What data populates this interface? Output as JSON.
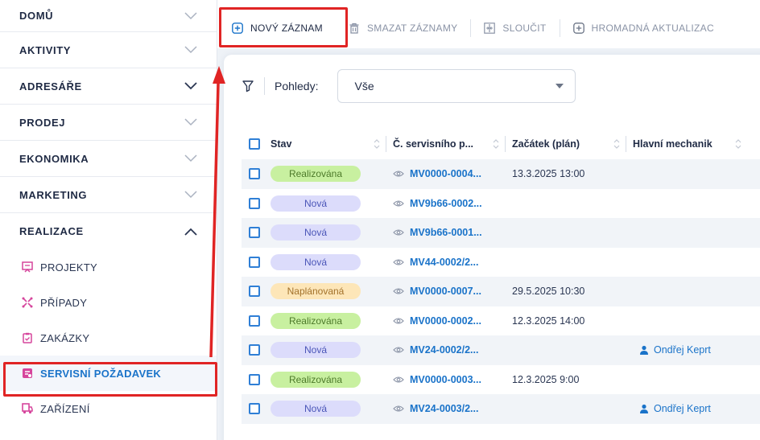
{
  "sidebar": {
    "sections": [
      {
        "label": "DOMŮ"
      },
      {
        "label": "AKTIVITY"
      },
      {
        "label": "ADRESÁŘE"
      },
      {
        "label": "PRODEJ"
      },
      {
        "label": "EKONOMIKA"
      },
      {
        "label": "MARKETING"
      },
      {
        "label": "REALIZACE"
      }
    ],
    "sub_items": [
      {
        "label": "PROJEKTY",
        "icon": "projects-icon"
      },
      {
        "label": "PŘÍPADY",
        "icon": "cases-icon"
      },
      {
        "label": "ZAKÁZKY",
        "icon": "orders-icon"
      },
      {
        "label": "SERVISNÍ POŽADAVEK",
        "icon": "service-request-icon"
      },
      {
        "label": "ZAŘÍZENÍ",
        "icon": "device-icon"
      }
    ]
  },
  "toolbar": {
    "new_label": "NOVÝ ZÁZNAM",
    "delete_label": "SMAZAT ZÁZNAMY",
    "merge_label": "SLOUČIT",
    "bulk_label": "HROMADNÁ AKTUALIZAC"
  },
  "filter": {
    "views_label": "Pohledy:",
    "views_value": "Vše"
  },
  "table": {
    "columns": [
      "Stav",
      "Č. servisního p...",
      "Začátek (plán)",
      "Hlavní mechanik"
    ],
    "rows": [
      {
        "status": "Realizována",
        "number": "MV0000-0004...",
        "start": "13.3.2025 13:00",
        "mechanic": ""
      },
      {
        "status": "Nová",
        "number": "MV9b66-0002...",
        "start": "",
        "mechanic": ""
      },
      {
        "status": "Nová",
        "number": "MV9b66-0001...",
        "start": "",
        "mechanic": ""
      },
      {
        "status": "Nová",
        "number": "MV44-0002/2...",
        "start": "",
        "mechanic": ""
      },
      {
        "status": "Naplánovaná",
        "number": "MV0000-0007...",
        "start": "29.5.2025 10:30",
        "mechanic": ""
      },
      {
        "status": "Realizována",
        "number": "MV0000-0002...",
        "start": "12.3.2025 14:00",
        "mechanic": ""
      },
      {
        "status": "Nová",
        "number": "MV24-0002/2...",
        "start": "",
        "mechanic": "Ondřej Keprt"
      },
      {
        "status": "Realizována",
        "number": "MV0000-0003...",
        "start": "12.3.2025 9:00",
        "mechanic": ""
      },
      {
        "status": "Nová",
        "number": "MV24-0003/2...",
        "start": "",
        "mechanic": "Ondřej Keprt"
      }
    ]
  },
  "colors": {
    "accent": "#1a73c9",
    "highlight": "#e02424",
    "status_realizovana": "#c8f0a0",
    "status_nova": "#dcdcfb",
    "status_naplanovana": "#fde6b8"
  }
}
